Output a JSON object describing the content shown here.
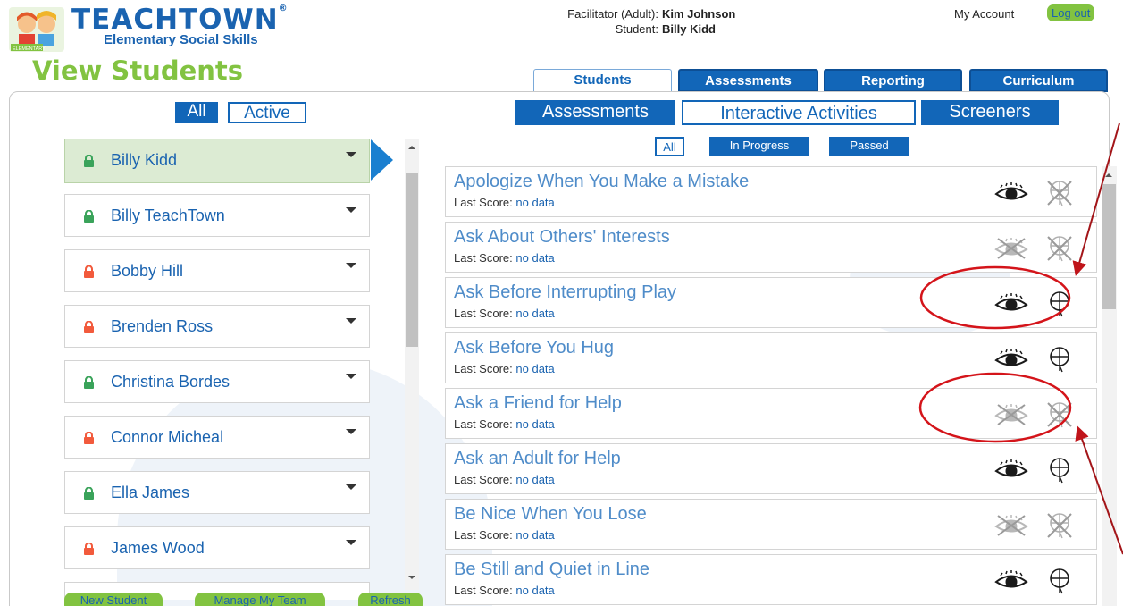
{
  "header": {
    "logo_title": "TEACHTOWN",
    "logo_subtitle": "Elementary Social Skills",
    "logo_badge": "ELEMENTARY",
    "facilitator_label": "Facilitator (Adult):",
    "facilitator_name": "Kim Johnson",
    "student_label": "Student:",
    "student_name": "Billy Kidd",
    "my_account": "My Account",
    "logout": "Log out"
  },
  "page_title": "View Students",
  "tabs": [
    {
      "label": "Students",
      "active": true
    },
    {
      "label": "Assessments",
      "active": false
    },
    {
      "label": "Reporting",
      "active": false
    },
    {
      "label": "Curriculum",
      "active": false
    }
  ],
  "student_filter": {
    "all": "All",
    "active": "Active"
  },
  "activity_types": {
    "assessments": "Assessments",
    "interactive": "Interactive Activities",
    "screeners": "Screeners"
  },
  "status_filter": {
    "all": "All",
    "in_progress": "In Progress",
    "passed": "Passed"
  },
  "students": [
    {
      "name": "Billy Kidd",
      "lock": "green",
      "selected": true
    },
    {
      "name": "Billy TeachTown",
      "lock": "green"
    },
    {
      "name": "Bobby Hill",
      "lock": "red"
    },
    {
      "name": "Brenden Ross",
      "lock": "red"
    },
    {
      "name": "Christina Bordes",
      "lock": "green"
    },
    {
      "name": "Connor Micheal",
      "lock": "red"
    },
    {
      "name": "Ella James",
      "lock": "green"
    },
    {
      "name": "James Wood",
      "lock": "red"
    }
  ],
  "bottom_buttons": {
    "new_student": "New Student",
    "manage_team": "Manage My Team",
    "refresh": "Refresh"
  },
  "activities": [
    {
      "title": "Apologize When You Make a Mistake",
      "score_label": "Last Score:",
      "score": "no data",
      "eye": "enabled",
      "cert": "disabled"
    },
    {
      "title": "Ask About Others' Interests",
      "score_label": "Last Score:",
      "score": "no data",
      "eye": "disabled",
      "cert": "disabled"
    },
    {
      "title": "Ask Before Interrupting Play",
      "score_label": "Last Score:",
      "score": "no data",
      "eye": "enabled",
      "cert": "enabled"
    },
    {
      "title": "Ask Before You Hug",
      "score_label": "Last Score:",
      "score": "no data",
      "eye": "enabled",
      "cert": "enabled"
    },
    {
      "title": "Ask a Friend for Help",
      "score_label": "Last Score:",
      "score": "no data",
      "eye": "disabled",
      "cert": "disabled"
    },
    {
      "title": "Ask an Adult for Help",
      "score_label": "Last Score:",
      "score": "no data",
      "eye": "enabled",
      "cert": "enabled"
    },
    {
      "title": "Be Nice When You Lose",
      "score_label": "Last Score:",
      "score": "no data",
      "eye": "disabled",
      "cert": "disabled"
    },
    {
      "title": "Be Still and Quiet in Line",
      "score_label": "Last Score:",
      "score": "no data",
      "eye": "enabled",
      "cert": "enabled"
    }
  ],
  "colors": {
    "brand_blue": "#1266b8",
    "brand_green": "#82c341",
    "lock_green": "#3aa35a",
    "lock_red": "#f25a3c",
    "annotation_red": "#d4141a"
  }
}
